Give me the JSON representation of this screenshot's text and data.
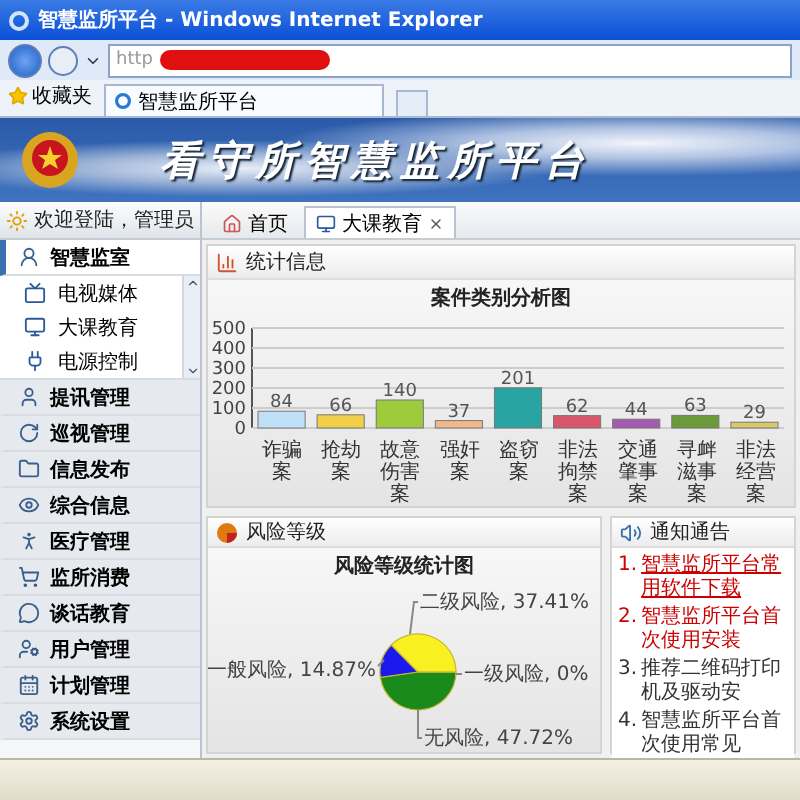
{
  "window": {
    "title": "智慧监所平台 - Windows Internet Explorer"
  },
  "address_bar": {
    "value": "http"
  },
  "favorites": {
    "label": "收藏夹"
  },
  "browser_tabs": [
    {
      "label": "智慧监所平台"
    }
  ],
  "banner": {
    "title": "看守所智慧监所平台"
  },
  "sidebar": {
    "greeting": "欢迎登陆，管理员",
    "groups": [
      {
        "label": "智慧监室",
        "expanded": true,
        "children": [
          {
            "label": "电视媒体"
          },
          {
            "label": "大课教育"
          },
          {
            "label": "电源控制"
          }
        ]
      },
      {
        "label": "提讯管理",
        "expanded": false
      },
      {
        "label": "巡视管理",
        "expanded": false
      },
      {
        "label": "信息发布",
        "expanded": false
      },
      {
        "label": "综合信息",
        "expanded": false
      },
      {
        "label": "医疗管理",
        "expanded": false
      },
      {
        "label": "监所消费",
        "expanded": false
      },
      {
        "label": "谈话教育",
        "expanded": false
      },
      {
        "label": "用户管理",
        "expanded": false
      },
      {
        "label": "计划管理",
        "expanded": false
      },
      {
        "label": "系统设置",
        "expanded": false
      }
    ]
  },
  "page_tabs": [
    {
      "label": "首页",
      "selected": false,
      "closable": false
    },
    {
      "label": "大课教育",
      "selected": true,
      "closable": true
    }
  ],
  "stats_panel": {
    "title": "统计信息",
    "chart_data": {
      "type": "bar",
      "title": "案件类别分析图",
      "categories": [
        "诈骗案",
        "抢劫案",
        "故意伤害案",
        "强奸案",
        "盗窃案",
        "非法拘禁案",
        "交通肇事案",
        "寻衅滋事案",
        "非法经营案"
      ],
      "values": [
        84,
        66,
        140,
        37,
        201,
        62,
        44,
        63,
        29
      ],
      "ylim": [
        0,
        500
      ],
      "yticks": [
        0,
        100,
        200,
        300,
        400,
        500
      ],
      "grid": true,
      "data_labels": true
    }
  },
  "risk_panel": {
    "title": "风险等级",
    "chart_data": {
      "type": "pie",
      "title": "风险等级统计图",
      "categories": [
        "无风险",
        "一般风险",
        "二级风险",
        "一级风险"
      ],
      "values": [
        47.72,
        14.87,
        37.41,
        0
      ],
      "value_labels": [
        ", 47.72%",
        ", 14.87%",
        ", 37.41%",
        ", 0%"
      ]
    }
  },
  "notice_panel": {
    "title": "通知通告",
    "items": [
      {
        "number": "1.",
        "text": "智慧监所平台常用软件下载",
        "color": "#cc0000",
        "selected": true
      },
      {
        "number": "2.",
        "text": "智慧监所平台首次使用安装",
        "color": "#cc0000",
        "selected": false
      },
      {
        "number": "3.",
        "text": "推荐二维码打印机及驱动安",
        "color": "#333333",
        "selected": false
      },
      {
        "number": "4.",
        "text": "智慧监所平台首次使用常见",
        "color": "#333333",
        "selected": false
      }
    ]
  }
}
